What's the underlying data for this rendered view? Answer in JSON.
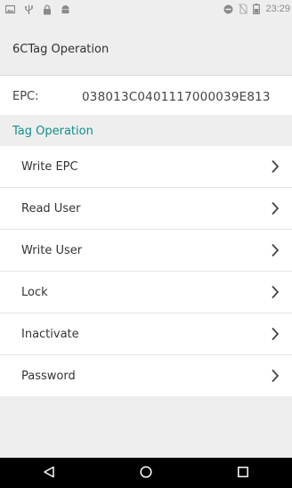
{
  "status_bar": {
    "time": "23:29",
    "left_icons": [
      "photo-icon",
      "usb-icon",
      "lock-icon",
      "android-icon"
    ],
    "right_icons": [
      "do-not-disturb-icon",
      "no-sim-icon",
      "battery-icon"
    ]
  },
  "app_bar": {
    "title": "6CTag Operation"
  },
  "epc": {
    "label": "EPC:",
    "value": "038013C0401117000039E813"
  },
  "section": {
    "title": "Tag Operation"
  },
  "menu": {
    "items": [
      {
        "label": "Write EPC"
      },
      {
        "label": "Read User"
      },
      {
        "label": "Write User"
      },
      {
        "label": "Lock"
      },
      {
        "label": "Inactivate"
      },
      {
        "label": "Password"
      }
    ]
  },
  "nav_bar": {
    "icons": [
      "back-icon",
      "home-icon",
      "recents-icon"
    ]
  },
  "colors": {
    "accent": "#138f8f",
    "background": "#eeeeee",
    "nav": "#000000"
  }
}
